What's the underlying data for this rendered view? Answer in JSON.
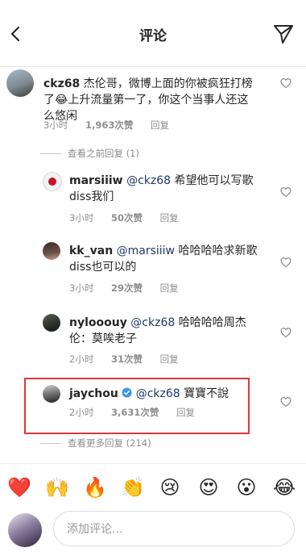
{
  "header": {
    "title": "评论"
  },
  "comments": [
    {
      "username": "ckz68",
      "text_a": "杰伦哥，微博上面的你被疯狂打榜",
      "text_b": "了",
      "text_c": "上升流量第一了，你这个当事人还这",
      "text_d": "么悠闲",
      "time": "3小时",
      "likes": "1,963次赞",
      "reply": "回复"
    }
  ],
  "view_prev": "查看之前回复 (1)",
  "replies": [
    {
      "username": "marsiiiw",
      "mention": "@ckz68",
      "text_a": "希望他可以写歌",
      "text_b": "diss我们",
      "time": "3小时",
      "likes": "50次赞",
      "reply": "回复"
    },
    {
      "username": "kk_van",
      "mention": "@marsiiiw",
      "text_a": "哈哈哈哈求新歌",
      "text_b": "diss也可以的",
      "time": "3小时",
      "likes": "29次赞",
      "reply": "回复"
    },
    {
      "username": "nylooouy",
      "mention": "@ckz68",
      "text_a": "哈哈哈哈周杰",
      "text_b": "伦：莫唉老子",
      "time": "2小时",
      "likes": "31次赞",
      "reply": "回复"
    },
    {
      "username": "jaychou",
      "mention": "@ckz68",
      "text_a": "寶寶不說",
      "time": "2小时",
      "likes": "3,631次赞",
      "reply": "回复"
    }
  ],
  "view_more": "查看更多回复 (214)",
  "emoji_bar": [
    "❤️",
    "🙌",
    "🔥",
    "👏",
    "😢",
    "😍",
    "😮",
    "😂"
  ],
  "input": {
    "placeholder": "添加评论..."
  },
  "colors": {
    "highlight": "#e0363f",
    "verified": "#3897f0",
    "mention": "#1d3a6b"
  },
  "icons": [
    "back-arrow-icon",
    "send-icon",
    "heart-icon",
    "verified-badge-icon"
  ]
}
